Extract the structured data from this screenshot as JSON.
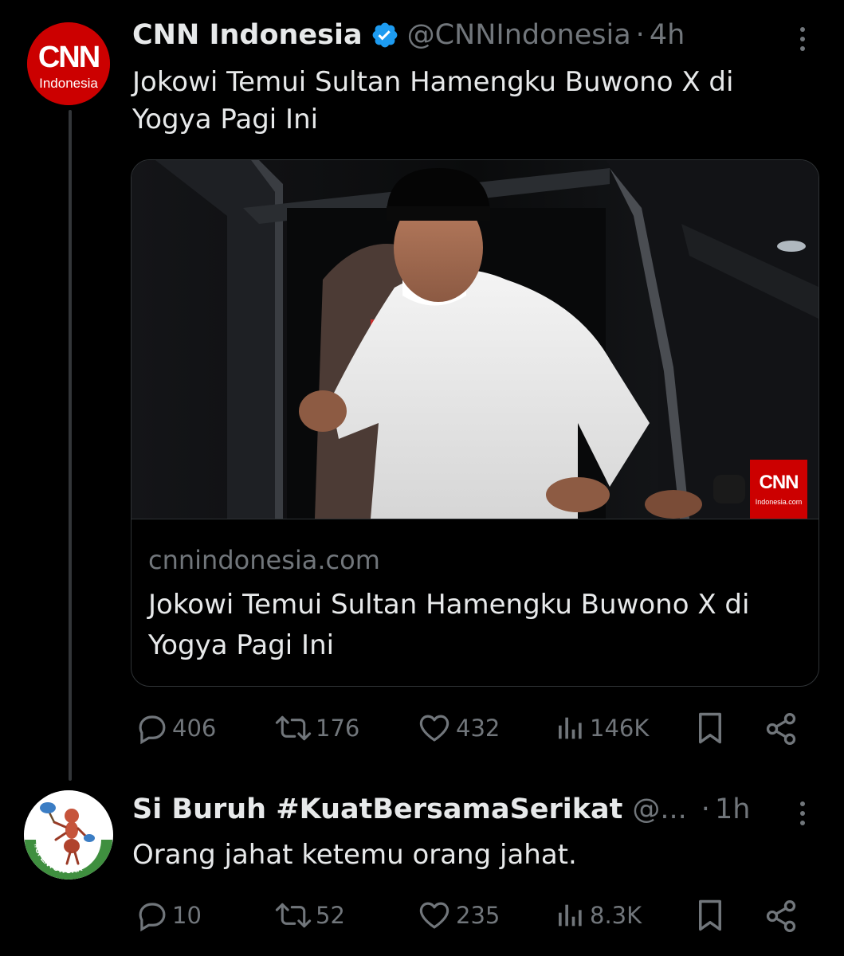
{
  "tweet1": {
    "name": "CNN Indonesia",
    "handle": "@CNNIndonesia",
    "separator": "·",
    "time": "4h",
    "text": "Jokowi Temui Sultan Hamengku Buwono X di Yogya Pagi Ini",
    "avatar_brand": "CNN",
    "avatar_sub": "Indonesia",
    "card": {
      "watermark_brand": "CNN",
      "watermark_sub": "Indonesia.com",
      "domain": "cnnindonesia.com",
      "title": "Jokowi Temui Sultan Hamengku Buwono X di Yogya Pagi Ini"
    },
    "stats": {
      "replies": "406",
      "reposts": "176",
      "likes": "432",
      "views": "146K"
    }
  },
  "tweet2": {
    "name": "Si Buruh #KuatBersamaSerikat",
    "handle": "@...",
    "separator": "·",
    "time": "1h",
    "text": "Orang jahat ketemu orang jahat.",
    "avatar_text": "#OPENTOWORK",
    "stats": {
      "replies": "10",
      "reposts": "52",
      "likes": "235",
      "views": "8.3K"
    }
  },
  "colors": {
    "background": "#000000",
    "primary_text": "#e7e9ea",
    "secondary_text": "#71767b",
    "verified": "#1d9bf0",
    "cnn_red": "#cc0000",
    "thread_line": "#333639"
  },
  "icons": [
    "verified-badge-icon",
    "more-icon",
    "reply-icon",
    "repost-icon",
    "like-icon",
    "views-icon",
    "bookmark-icon",
    "share-icon"
  ]
}
